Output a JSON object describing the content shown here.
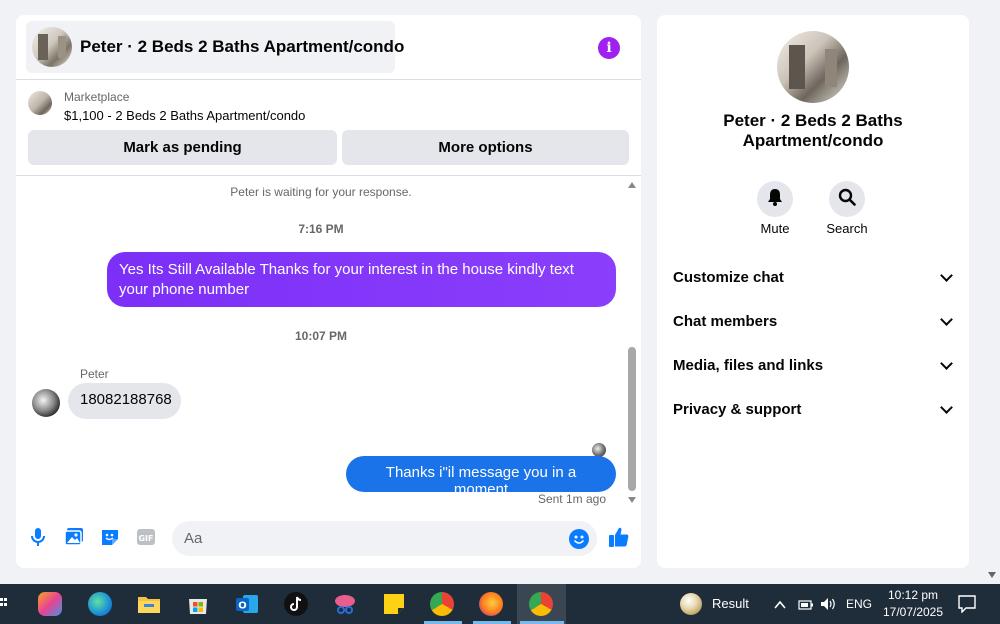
{
  "header": {
    "title": "Peter · 2 Beds 2 Baths Apartment/condo"
  },
  "marketplace": {
    "label": "Marketplace",
    "listing": "$1,100 - 2 Beds 2 Baths Apartment/condo"
  },
  "actions": {
    "mark_pending": "Mark as pending",
    "more_options": "More options"
  },
  "messages": {
    "waiting_notice": "Peter is waiting for your response.",
    "time_1": "7:16 PM",
    "outgoing_1": "Yes Its Still Available Thanks for your interest in the house kindly text your phone number",
    "time_2": "10:07 PM",
    "sender_name": "Peter",
    "incoming_1": "18082188768",
    "outgoing_2": "Thanks i\"il message you in a moment",
    "sent_status": "Sent 1m ago"
  },
  "composer": {
    "placeholder": "Aa"
  },
  "info_panel": {
    "name": "Peter · 2 Beds 2 Baths Apartment/condo",
    "mute_label": "Mute",
    "search_label": "Search",
    "sections": [
      "Customize chat",
      "Chat members",
      "Media, files and links",
      "Privacy & support"
    ]
  },
  "taskbar": {
    "weather_label": "Result",
    "language": "ENG",
    "time": "10:12 pm",
    "date": "17/07/2025"
  },
  "colors": {
    "accent_purple": "#7b2ff7",
    "accent_blue": "#1a73e8",
    "messenger_blue": "#0a7cff",
    "info_purple": "#a020f0"
  }
}
